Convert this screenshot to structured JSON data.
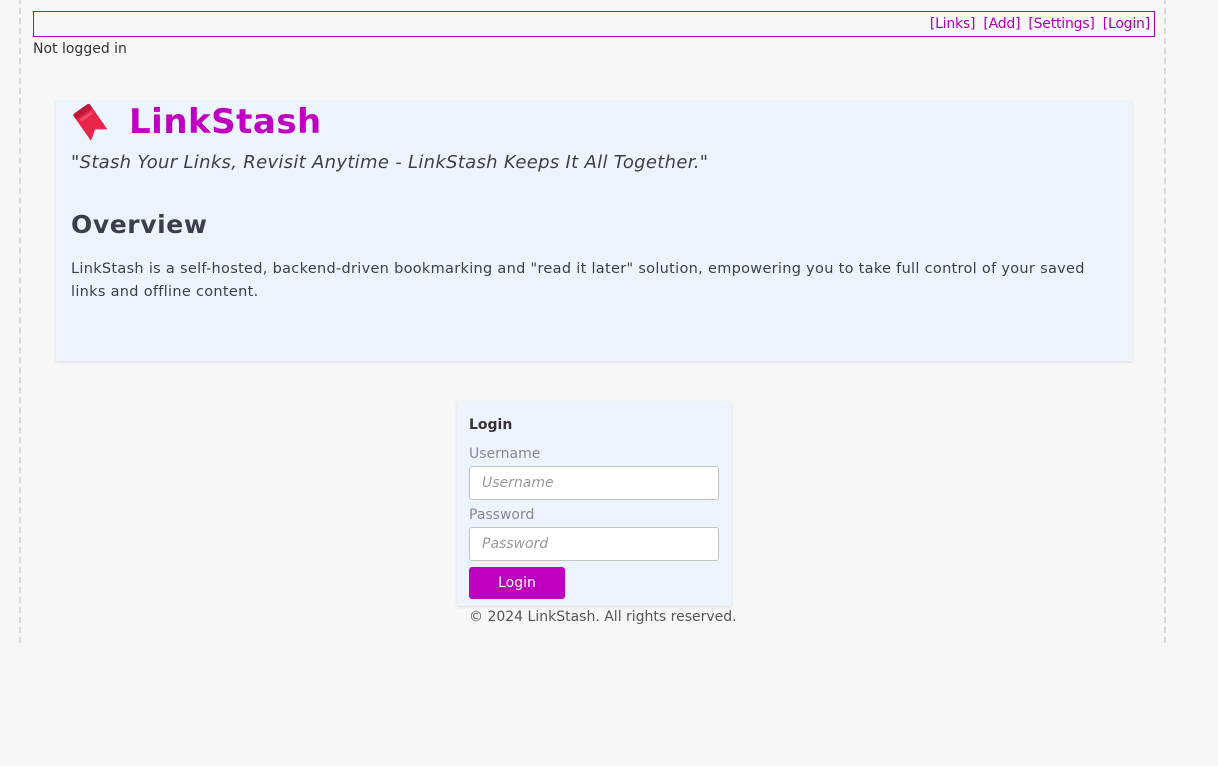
{
  "nav": {
    "links": [
      {
        "label": "[Links]"
      },
      {
        "label": "[Add]"
      },
      {
        "label": "[Settings]"
      },
      {
        "label": "[Login]"
      }
    ],
    "color": "#b000b0"
  },
  "status": {
    "text": "Not logged in"
  },
  "hero": {
    "icon": "bookmark-icon",
    "title": "LinkStash",
    "tagline_open": "\"",
    "tagline": "Stash Your Links, Revisit Anytime - LinkStash Keeps It All Together.",
    "tagline_close": "\"",
    "overview_heading": "Overview",
    "overview_text": "LinkStash is a self-hosted, backend-driven bookmarking and \"read it later\" solution, empowering you to take full control of your saved links and offline content."
  },
  "login": {
    "heading": "Login",
    "username_label": "Username",
    "username_placeholder": "Username",
    "username_value": "",
    "password_label": "Password",
    "password_placeholder": "Password",
    "password_value": "",
    "button_label": "Login"
  },
  "footer": {
    "text": "© 2024 LinkStash. All rights reserved."
  },
  "colors": {
    "accent": "#c000c0",
    "panel_background": "#eef4fd",
    "page_background": "#f7f7f7"
  }
}
